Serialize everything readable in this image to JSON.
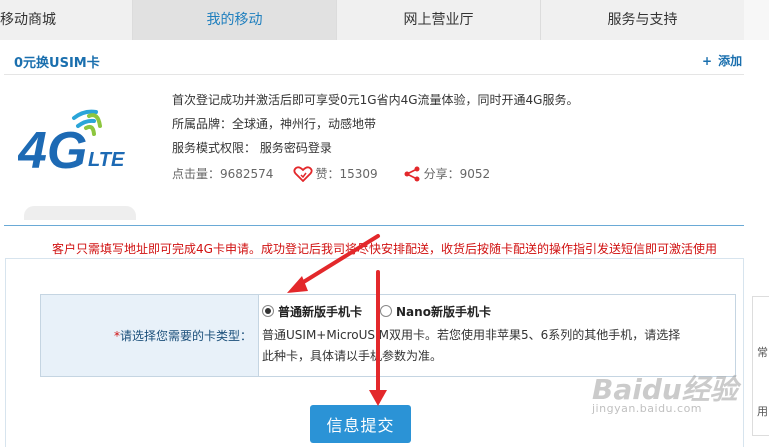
{
  "nav": {
    "tabs": [
      {
        "label": "移动商城"
      },
      {
        "label": "我的移动"
      },
      {
        "label": "网上营业厅"
      },
      {
        "label": "服务与支持"
      }
    ],
    "active_index": 1
  },
  "card": {
    "title": "0元换USIM卡",
    "add_plus": "+",
    "add_label": "添加",
    "description": "首次登记成功并激活后即可享受0元1G省内4G流量体验，同时开通4G服务。",
    "brand": "所属品牌：全球通，神州行，动感地带",
    "permission": "服务模式权限： 服务密码登录",
    "clicks": "点击量：9682574",
    "likes": "赞：15309",
    "shares": "分享：9052"
  },
  "notice": "客户只需填写地址即可完成4G卡申请。成功登记后我司将尽快安排配送，收货后按随卡配送的操作指引发送短信即可激活使用",
  "form": {
    "required_mark": "*",
    "label": "请选择您需要的卡类型：",
    "options": [
      {
        "label": "普通新版手机卡",
        "checked": true
      },
      {
        "label": "Nano新版手机卡",
        "checked": false
      }
    ],
    "option_description": "普通USIM+MicroUSIM双用卡。若您使用非苹果5、6系列的其他手机，请选择此种卡，具体请以手机参数为准。",
    "submit_label": "信息提交"
  },
  "side": {
    "chars": [
      "常",
      "用"
    ]
  },
  "watermark": {
    "text": "Baidu经验",
    "sub": "jingyan.baidu.com"
  },
  "colors": {
    "accent": "#1a6fae",
    "notice_red": "#d01111",
    "button_blue": "#2b93d6",
    "annotation_red": "#e3282b"
  },
  "icons": {
    "like": "heart-icon",
    "share": "share-icon",
    "logo": "4g-lte-logo"
  }
}
